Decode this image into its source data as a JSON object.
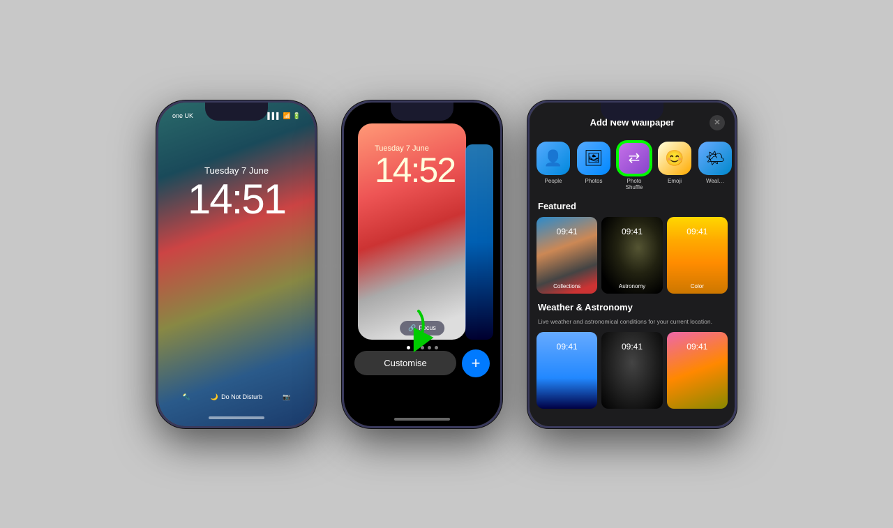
{
  "scene": {
    "background": "#c8c8c8"
  },
  "phone1": {
    "status_left": "one UK",
    "status_right_signal": "▌▌▌",
    "status_right_wifi": "WiFi",
    "status_right_battery": "🔋",
    "date": "Tuesday 7 June",
    "time": "14:51",
    "bottom_flashlight": "🔦",
    "bottom_dnd": "Do Not Disturb",
    "bottom_camera": "📷",
    "home_indicator": ""
  },
  "phone2": {
    "date": "Tuesday 7 June",
    "time": "14:52",
    "focus_label": "Focus",
    "customise_label": "Customise",
    "plus_label": "+"
  },
  "phone3": {
    "header_title": "Add New Wallpaper",
    "close_label": "✕",
    "categories": [
      {
        "id": "people",
        "icon": "👤",
        "label": "People",
        "style": "people"
      },
      {
        "id": "photos",
        "icon": "🖼",
        "label": "Photos",
        "style": "photos"
      },
      {
        "id": "photo-shuffle",
        "icon": "⇄",
        "label": "Photo\nShuffle",
        "style": "photo-shuffle"
      },
      {
        "id": "emoji",
        "icon": "😊",
        "label": "Emoji",
        "style": "emoji"
      },
      {
        "id": "weather",
        "icon": "🌤",
        "label": "Weat…",
        "style": "weather"
      }
    ],
    "featured_title": "Featured",
    "featured_items": [
      {
        "label": "Collections",
        "time": "09:41",
        "class": "thumb1"
      },
      {
        "label": "Astronomy",
        "time": "09:41",
        "class": "thumb2"
      },
      {
        "label": "Color",
        "time": "09:41",
        "class": "thumb3"
      }
    ],
    "weather_title": "Weather & Astronomy",
    "weather_desc": "Live weather and astronomical conditions for your current location.",
    "weather_items": [
      {
        "time": "09:41",
        "class": "thumb4"
      },
      {
        "time": "09:41",
        "class": "thumb5"
      },
      {
        "time": "09:41",
        "class": "thumb6"
      }
    ]
  }
}
